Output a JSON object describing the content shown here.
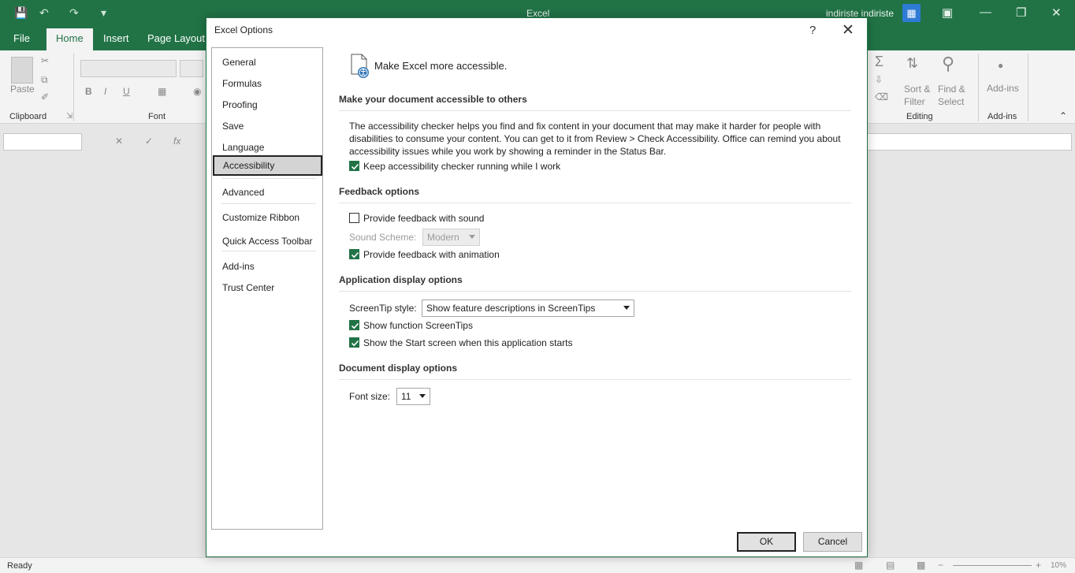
{
  "titlebar": {
    "app_title": "Excel",
    "user_name": "indiriste indiriste"
  },
  "ribbon_tabs": [
    "File",
    "Home",
    "Insert",
    "Page Layout"
  ],
  "ribbon": {
    "paste_label": "Paste",
    "clipboard_group": "Clipboard",
    "font_group": "Font",
    "bold": "B",
    "italic": "I",
    "underline": "U",
    "sort_filter": "Sort &\nFilter",
    "find_select": "Find &\nSelect",
    "editing_group": "Editing",
    "addins_button": "Add-ins",
    "addins_group": "Add-ins"
  },
  "statusbar": {
    "ready": "Ready",
    "zoom": "10%"
  },
  "dialog": {
    "title": "Excel Options",
    "help": "?",
    "categories": [
      "General",
      "Formulas",
      "Proofing",
      "Save",
      "Language",
      "Accessibility",
      "Advanced",
      "Customize Ribbon",
      "Quick Access Toolbar",
      "Add-ins",
      "Trust Center"
    ],
    "selected_category": "Accessibility",
    "header": "Make Excel more accessible.",
    "sections": {
      "accessible": {
        "title": "Make your document accessible to others",
        "description": "The accessibility checker helps you find and fix content in your document that may make it harder for people with disabilities to consume your content. You can get to it from Review > Check Accessibility. Office can remind you about accessibility issues while you work by showing a reminder in the Status Bar.",
        "keep_checker": "Keep accessibility checker running while I work"
      },
      "feedback": {
        "title": "Feedback options",
        "sound": "Provide feedback with sound",
        "sound_scheme_label": "Sound Scheme:",
        "sound_scheme_value": "Modern",
        "animation": "Provide feedback with animation"
      },
      "app_display": {
        "title": "Application display options",
        "screentip_label": "ScreenTip style:",
        "screentip_value": "Show feature descriptions in ScreenTips",
        "show_function_tips": "Show function ScreenTips",
        "show_start_screen": "Show the Start screen when this application starts"
      },
      "doc_display": {
        "title": "Document display options",
        "font_size_label": "Font size:",
        "font_size_value": "11"
      }
    },
    "checkbox_state": {
      "keep_checker": true,
      "sound": false,
      "animation": true,
      "show_function_tips": true,
      "show_start_screen": true
    },
    "ok": "OK",
    "cancel": "Cancel"
  },
  "colors": {
    "brand": "#217346",
    "selection": "#d4d4d4"
  }
}
